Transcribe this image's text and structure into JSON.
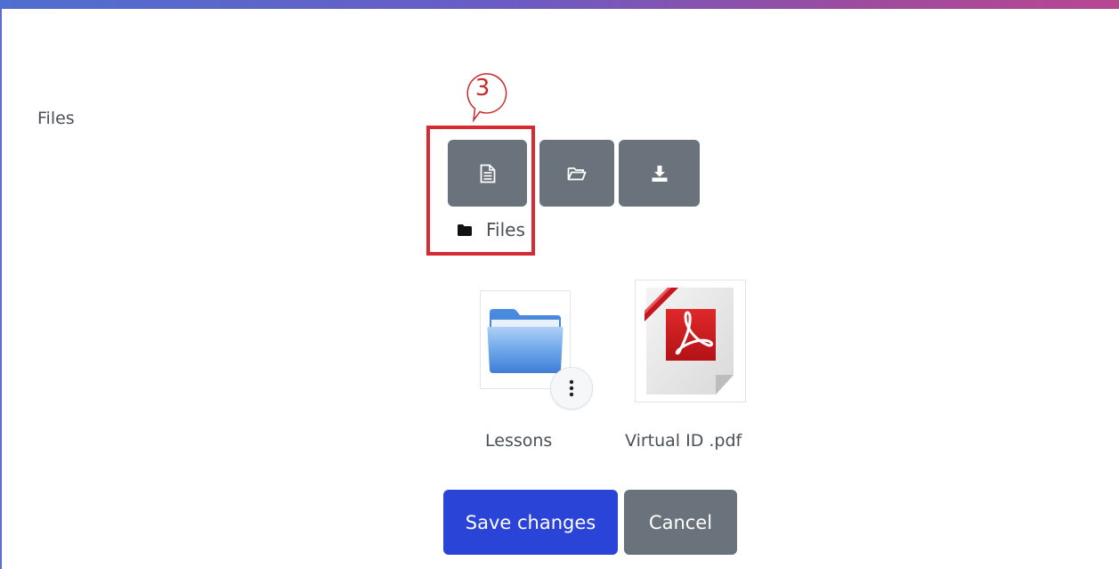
{
  "form": {
    "label": "Files"
  },
  "toolbar": {
    "add_icon": "file-add-icon",
    "folder_icon": "create-folder-icon",
    "download_icon": "download-icon"
  },
  "breadcrumb": {
    "path": "Files",
    "icon": "folder-icon"
  },
  "annotation": {
    "step": "3",
    "color": "#d62b35"
  },
  "files": [
    {
      "name": "Lessons",
      "icon": "folder-icon"
    },
    {
      "name": "Virtual ID .pdf",
      "icon": "pdf-icon"
    }
  ],
  "actions": {
    "save_label": "Save changes",
    "cancel_label": "Cancel"
  },
  "colors": {
    "accent": "#2b44d8",
    "secondary": "#6a737b"
  }
}
